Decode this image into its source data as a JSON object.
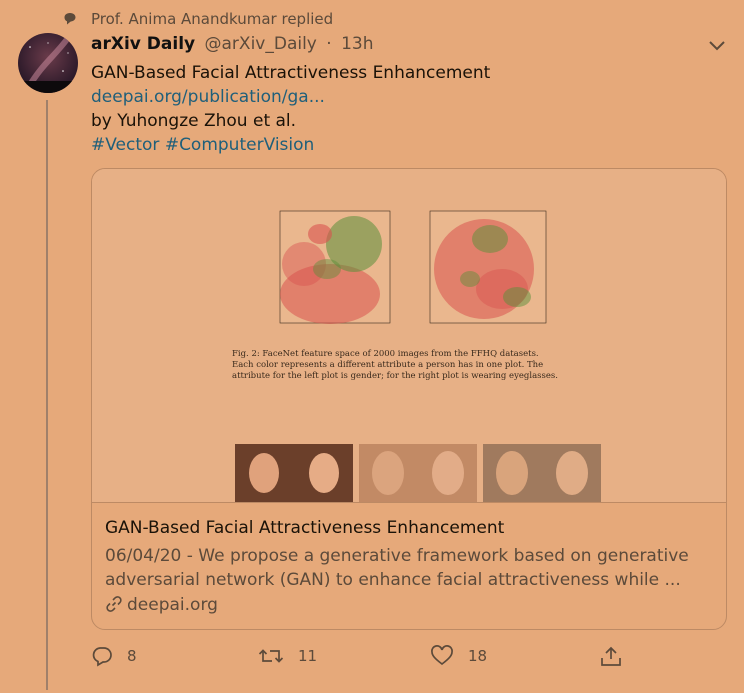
{
  "context": {
    "icon": "reply-bubble-icon",
    "text": "Prof. Anima Anandkumar replied"
  },
  "tweet": {
    "name": "arXiv Daily",
    "handle": "@arXiv_Daily",
    "separator": "·",
    "time": "13h",
    "lines": [
      {
        "text": "GAN-Based Facial Attractiveness Enhancement"
      },
      {
        "text": "deepai.org/publication/ga..."
      },
      {
        "text": "by Yuhongze Zhou et al."
      },
      {
        "text": "#Vector #ComputerVision"
      }
    ]
  },
  "card": {
    "figure_caption": "Fig. 2: FaceNet feature space of 2000 images from the FFHQ datasets. Each color represents a different attribute a person has in one plot. The attribute for the left plot is gender; for the right plot is wearing eyeglasses.",
    "title": "GAN-Based Facial Attractiveness Enhancement",
    "description": "06/04/20 - We propose a generative framework based on generative adversarial network (GAN) to enhance facial attractiveness while ...",
    "domain": "deepai.org",
    "domain_icon": "link-icon"
  },
  "actions": {
    "reply": {
      "icon": "reply-icon",
      "count": "8"
    },
    "retweet": {
      "icon": "retweet-icon",
      "count": "11"
    },
    "like": {
      "icon": "heart-icon",
      "count": "18"
    },
    "share": {
      "icon": "share-icon"
    }
  },
  "colors": {
    "background": "#e6a97a",
    "link": "#1f5f7a",
    "secondary_text": "#5c4a3a",
    "scatter_red": "#d9534f",
    "scatter_green": "#5a8f3a"
  }
}
